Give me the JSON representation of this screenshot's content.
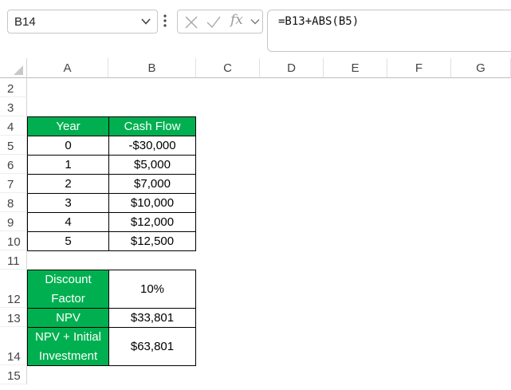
{
  "formula_bar": {
    "name_box": "B14",
    "fx_label": "fx",
    "formula": "=B13+ABS(B5)"
  },
  "columns": [
    "A",
    "B",
    "C",
    "D",
    "E",
    "F",
    "G"
  ],
  "rows": [
    "2",
    "3",
    "4",
    "5",
    "6",
    "7",
    "8",
    "9",
    "10",
    "11",
    "12",
    "13",
    "14",
    "15"
  ],
  "cash_flow_table": {
    "headers": {
      "year": "Year",
      "cash_flow": "Cash Flow"
    },
    "rows": [
      {
        "year": "0",
        "cash_flow": "-$30,000"
      },
      {
        "year": "1",
        "cash_flow": "$5,000"
      },
      {
        "year": "2",
        "cash_flow": "$7,000"
      },
      {
        "year": "3",
        "cash_flow": "$10,000"
      },
      {
        "year": "4",
        "cash_flow": "$12,000"
      },
      {
        "year": "5",
        "cash_flow": "$12,500"
      }
    ]
  },
  "summary": {
    "discount_label_1": "Discount",
    "discount_label_2": "Factor",
    "discount_value": "10%",
    "npv_label": "NPV",
    "npv_value": "$33,801",
    "npv_plus_label_1": "NPV + Initial",
    "npv_plus_label_2": "Investment",
    "npv_plus_value": "$63,801"
  },
  "colors": {
    "header_green": "#00b050",
    "header_text": "#ffffff"
  }
}
